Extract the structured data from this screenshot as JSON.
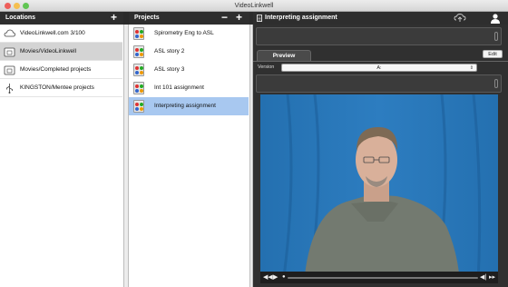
{
  "window": {
    "title": "VideoLinkwell"
  },
  "locations": {
    "header": "Locations",
    "add_label": "+",
    "items": [
      {
        "label": "VideoLinkwell.com 3/100",
        "icon": "cloud-icon",
        "selected": false
      },
      {
        "label": "Movies/VideoLinkwell",
        "icon": "folder-icon",
        "selected": true
      },
      {
        "label": "Movies/Completed projects",
        "icon": "folder-icon",
        "selected": false
      },
      {
        "label": "KINGSTON/Mentee projects",
        "icon": "usb-icon",
        "selected": false
      }
    ]
  },
  "projects": {
    "header": "Projects",
    "remove_label": "−",
    "add_label": "+",
    "items": [
      {
        "label": "Spirometry Eng to ASL",
        "selected": false
      },
      {
        "label": "ASL story 2",
        "selected": false
      },
      {
        "label": "ASL story 3",
        "selected": false
      },
      {
        "label": "Int 101 assignment",
        "selected": false
      },
      {
        "label": "Interpreting assignment",
        "selected": true
      }
    ]
  },
  "detail": {
    "header": "Interpreting assignment",
    "tab_label": "Preview",
    "edit_label": "Edit",
    "version_label": "Version",
    "version_value": "A:"
  },
  "colors": {
    "header_bg": "#2e2e2e",
    "selection_blue": "#a8c8f0",
    "video_backdrop": "#2a79b8"
  }
}
